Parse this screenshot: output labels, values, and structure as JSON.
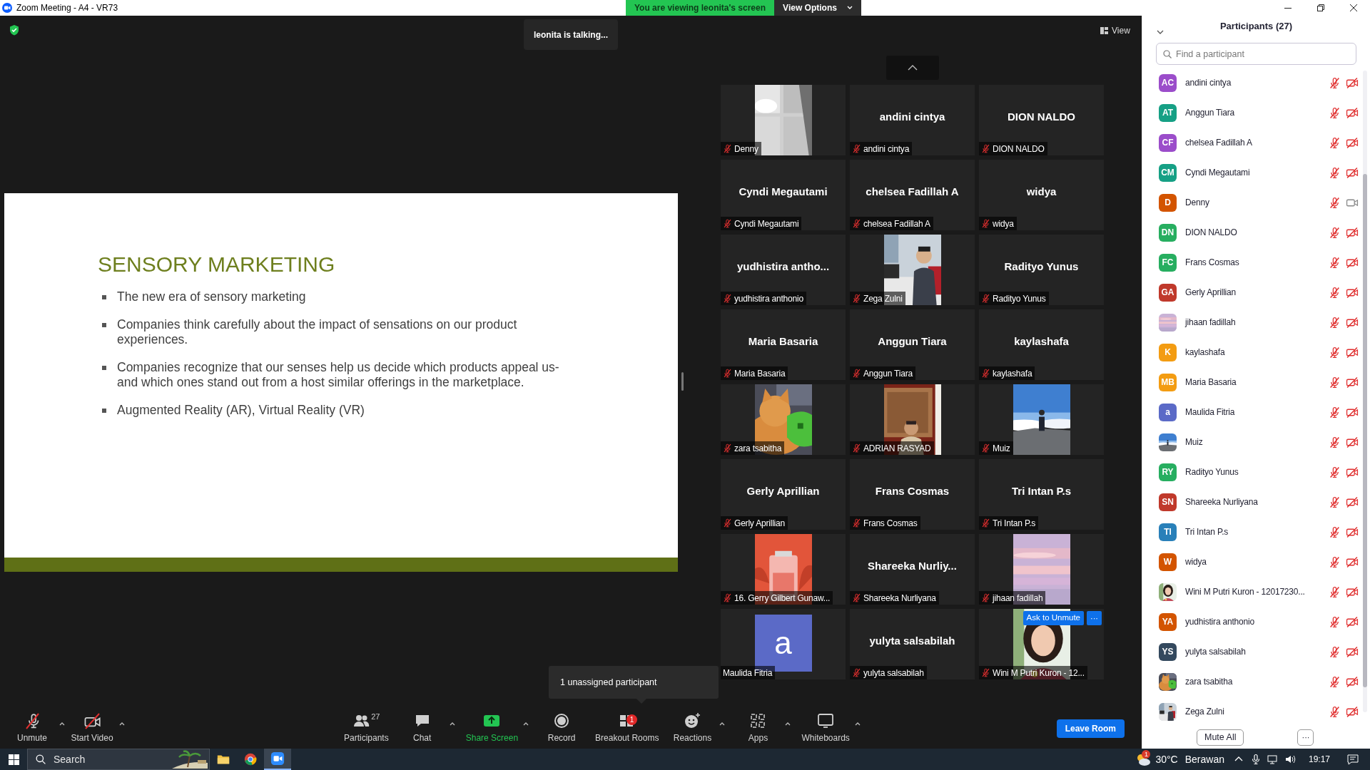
{
  "window": {
    "title": "Zoom Meeting - A4 - VR73"
  },
  "share_banner": {
    "status": "You are viewing leonita's screen",
    "view_options": "View Options"
  },
  "talking_toast": "leonita is talking...",
  "view_button": "View",
  "slide": {
    "title": "SENSORY MARKETING",
    "bullets": [
      "The new era of sensory marketing",
      "Companies think carefully about the impact of sensations on our product experiences.",
      "Companies recognize that our senses help us decide which products appeal us-and which ones stand out from a host similar offerings in the marketplace.",
      "Augmented Reality (AR), Virtual Reality (VR)"
    ]
  },
  "tiles": [
    {
      "kind": "picture",
      "label": "Denny",
      "muted": true
    },
    {
      "kind": "name",
      "heading": "andini cintya",
      "label": "andini cintya",
      "muted": true
    },
    {
      "kind": "name",
      "heading": "DION NALDO",
      "label": "DION NALDO",
      "muted": true
    },
    {
      "kind": "name",
      "heading": "Cyndi Megautami",
      "label": "Cyndi Megautami",
      "muted": true
    },
    {
      "kind": "name",
      "heading": "chelsea Fadillah A",
      "label": "chelsea Fadillah A",
      "muted": true
    },
    {
      "kind": "name",
      "heading": "widya",
      "label": "widya",
      "muted": true
    },
    {
      "kind": "name",
      "heading": "yudhistira antho...",
      "label": "yudhistira anthonio",
      "muted": true
    },
    {
      "kind": "picture",
      "label": "Zega Zulni",
      "muted": true
    },
    {
      "kind": "name",
      "heading": "Radityo Yunus",
      "label": "Radityo Yunus",
      "muted": true
    },
    {
      "kind": "name",
      "heading": "Maria Basaria",
      "label": "Maria Basaria",
      "muted": true
    },
    {
      "kind": "name",
      "heading": "Anggun Tiara",
      "label": "Anggun Tiara",
      "muted": true
    },
    {
      "kind": "name",
      "heading": "kaylashafa",
      "label": "kaylashafa",
      "muted": true
    },
    {
      "kind": "picture",
      "label": "zara tsabitha",
      "muted": true
    },
    {
      "kind": "picture",
      "label": "ADRIAN RASYAD",
      "muted": true
    },
    {
      "kind": "picture",
      "label": "Muiz",
      "muted": true
    },
    {
      "kind": "name",
      "heading": "Gerly Aprillian",
      "label": "Gerly Aprillian",
      "muted": true
    },
    {
      "kind": "name",
      "heading": "Frans Cosmas",
      "label": "Frans Cosmas",
      "muted": true
    },
    {
      "kind": "name",
      "heading": "Tri Intan P.s",
      "label": "Tri Intan P.s",
      "muted": true
    },
    {
      "kind": "picture",
      "label": "16. Gerry Gilbert Gunaw...",
      "muted": true
    },
    {
      "kind": "name",
      "heading": "Shareeka Nurliy...",
      "label": "Shareeka Nurliyana",
      "muted": true
    },
    {
      "kind": "picture",
      "label": "jihaan fadillah",
      "muted": true
    },
    {
      "kind": "avatar",
      "letter": "a",
      "color": "#5b6ac7",
      "label": "Maulida Fitria"
    },
    {
      "kind": "name",
      "heading": "yulyta salsabilah",
      "label": "yulyta salsabilah",
      "muted": true
    },
    {
      "kind": "picture",
      "label": "Wini M Putri Kuron - 12...",
      "muted": true,
      "ask_button": "Ask to Unmute",
      "more_button": "···"
    }
  ],
  "tooltip": "1 unassigned participant",
  "toolbar": [
    {
      "kind": "unmute",
      "label": "Unmute",
      "caret": true
    },
    {
      "kind": "video",
      "label": "Start Video",
      "caret": true
    },
    {
      "kind": "participants",
      "label": "Participants",
      "count": "27",
      "caret": false
    },
    {
      "kind": "chat",
      "label": "Chat",
      "caret": true
    },
    {
      "kind": "share",
      "label": "Share Screen",
      "caret": true
    },
    {
      "kind": "record",
      "label": "Record",
      "caret": false
    },
    {
      "kind": "breakout",
      "label": "Breakout Rooms",
      "badge": "1",
      "caret": false
    },
    {
      "kind": "reactions",
      "label": "Reactions",
      "caret": true
    },
    {
      "kind": "apps",
      "label": "Apps",
      "caret": true
    },
    {
      "kind": "whiteboards",
      "label": "Whiteboards",
      "caret": true
    }
  ],
  "leave_button": "Leave Room",
  "participants_panel": {
    "title": "Participants (27)",
    "search_placeholder": "Find a participant",
    "participants": [
      {
        "name": "andini cintya",
        "kind": "initials",
        "initials": "AC",
        "color": "#9b4dca",
        "muted": true,
        "video": false
      },
      {
        "name": "Anggun Tiara",
        "kind": "initials",
        "initials": "AT",
        "color": "#16a085",
        "muted": true,
        "video": false
      },
      {
        "name": "chelsea Fadillah A",
        "kind": "initials",
        "initials": "CF",
        "color": "#9b4dca",
        "muted": true,
        "video": false
      },
      {
        "name": "Cyndi Megautami",
        "kind": "initials",
        "initials": "CM",
        "color": "#16a085",
        "muted": true,
        "video": false
      },
      {
        "name": "Denny",
        "kind": "initials",
        "initials": "D",
        "color": "#d35400",
        "muted": true,
        "video": true
      },
      {
        "name": "DION NALDO",
        "kind": "initials",
        "initials": "DN",
        "color": "#27ae60",
        "muted": true,
        "video": false
      },
      {
        "name": "Frans Cosmas",
        "kind": "initials",
        "initials": "FC",
        "color": "#27ae60",
        "muted": true,
        "video": false
      },
      {
        "name": "Gerly Aprillian",
        "kind": "initials",
        "initials": "GA",
        "color": "#c0392b",
        "muted": true,
        "video": false
      },
      {
        "name": "jihaan fadillah",
        "kind": "picture",
        "muted": true,
        "video": false
      },
      {
        "name": "kaylashafa",
        "kind": "initials",
        "initials": "K",
        "color": "#f39c12",
        "muted": true,
        "video": false
      },
      {
        "name": "Maria Basaria",
        "kind": "initials",
        "initials": "MB",
        "color": "#f39c12",
        "muted": true,
        "video": false
      },
      {
        "name": "Maulida Fitria",
        "kind": "initials",
        "initials": "a",
        "color": "#5b6ac7",
        "muted": true,
        "video": false
      },
      {
        "name": "Muiz",
        "kind": "picture",
        "muted": true,
        "video": false
      },
      {
        "name": "Radityo Yunus",
        "kind": "initials",
        "initials": "RY",
        "color": "#27ae60",
        "muted": true,
        "video": false
      },
      {
        "name": "Shareeka Nurliyana",
        "kind": "initials",
        "initials": "SN",
        "color": "#c0392b",
        "muted": true,
        "video": false
      },
      {
        "name": "Tri Intan P.s",
        "kind": "initials",
        "initials": "TI",
        "color": "#2980b9",
        "muted": true,
        "video": false
      },
      {
        "name": "widya",
        "kind": "initials",
        "initials": "W",
        "color": "#d35400",
        "muted": true,
        "video": false
      },
      {
        "name": "Wini M Putri Kuron - 12017230...",
        "kind": "picture",
        "muted": true,
        "video": false
      },
      {
        "name": "yudhistira anthonio",
        "kind": "initials",
        "initials": "YA",
        "color": "#d35400",
        "muted": true,
        "video": false
      },
      {
        "name": "yulyta salsabilah",
        "kind": "initials",
        "initials": "YS",
        "color": "#34495e",
        "muted": true,
        "video": false
      },
      {
        "name": "zara tsabitha",
        "kind": "picture",
        "muted": true,
        "video": false
      },
      {
        "name": "Zega Zulni",
        "kind": "picture",
        "muted": true,
        "video": false
      }
    ],
    "mute_all": "Mute All",
    "more_button": "···"
  },
  "taskbar": {
    "search_placeholder": "Search",
    "weather_badge": "1",
    "temperature": "30°C",
    "weather": "Berawan",
    "time": "19:17"
  }
}
